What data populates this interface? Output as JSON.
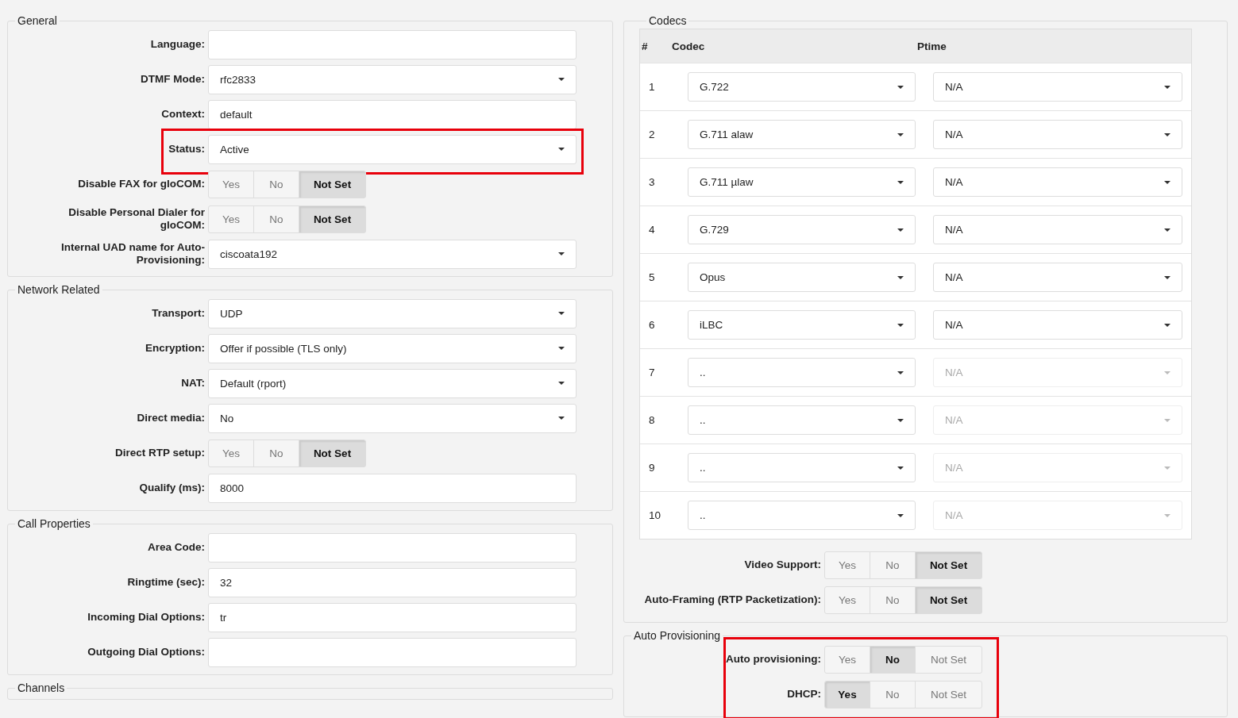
{
  "left_sections": [
    {
      "legend": "General",
      "highlighted": false,
      "fields": [
        {
          "kind": "text",
          "label": "Language:",
          "highlighted": false
        },
        {
          "kind": "select",
          "label": "DTMF Mode:",
          "value": "rfc2833",
          "highlighted": false
        },
        {
          "kind": "text",
          "label": "Context:",
          "value": "default",
          "highlighted": false
        },
        {
          "kind": "select",
          "label": "Status:",
          "value": "Active",
          "highlighted": true
        },
        {
          "kind": "toggle",
          "label": "Disable FAX for gloCOM:",
          "highlighted": false,
          "options": [
            {
              "label": "Yes",
              "selected": false
            },
            {
              "label": "No",
              "selected": false
            },
            {
              "label": "Not Set",
              "selected": true
            }
          ]
        },
        {
          "kind": "toggle",
          "label": "Disable Personal Dialer for gloCOM:",
          "highlighted": false,
          "options": [
            {
              "label": "Yes",
              "selected": false
            },
            {
              "label": "No",
              "selected": false
            },
            {
              "label": "Not Set",
              "selected": true
            }
          ]
        },
        {
          "kind": "select",
          "label": "Internal UAD name for Auto-Provisioning:",
          "value": "ciscoata192",
          "highlighted": false
        }
      ]
    },
    {
      "legend": "Network Related",
      "highlighted": false,
      "fields": [
        {
          "kind": "select",
          "label": "Transport:",
          "value": "UDP",
          "highlighted": false
        },
        {
          "kind": "select",
          "label": "Encryption:",
          "value": "Offer if possible (TLS only)",
          "highlighted": false
        },
        {
          "kind": "select",
          "label": "NAT:",
          "value": "Default (rport)",
          "highlighted": false
        },
        {
          "kind": "select",
          "label": "Direct media:",
          "value": "No",
          "highlighted": false
        },
        {
          "kind": "toggle",
          "label": "Direct RTP setup:",
          "highlighted": false,
          "options": [
            {
              "label": "Yes",
              "selected": false
            },
            {
              "label": "No",
              "selected": false
            },
            {
              "label": "Not Set",
              "selected": true
            }
          ]
        },
        {
          "kind": "text",
          "label": "Qualify (ms):",
          "value": "8000",
          "highlighted": false
        }
      ]
    },
    {
      "legend": "Call Properties",
      "highlighted": false,
      "fields": [
        {
          "kind": "text",
          "label": "Area Code:",
          "highlighted": false
        },
        {
          "kind": "text",
          "label": "Ringtime (sec):",
          "value": "32",
          "highlighted": false
        },
        {
          "kind": "text",
          "label": "Incoming Dial Options:",
          "value": "tr",
          "highlighted": false
        },
        {
          "kind": "text",
          "label": "Outgoing Dial Options:",
          "highlighted": false
        }
      ]
    },
    {
      "legend": "Channels",
      "highlighted": false
    }
  ],
  "codecs": {
    "legend": "Codecs",
    "columns": [
      "#",
      "Codec",
      "Ptime"
    ],
    "rows": [
      {
        "number": "1",
        "codec": "G.722",
        "ptime": "N/A",
        "ptime_disabled": false
      },
      {
        "number": "2",
        "codec": "G.711 alaw",
        "ptime": "N/A",
        "ptime_disabled": false
      },
      {
        "number": "3",
        "codec": "G.711 µlaw",
        "ptime": "N/A",
        "ptime_disabled": false
      },
      {
        "number": "4",
        "codec": "G.729",
        "ptime": "N/A",
        "ptime_disabled": false
      },
      {
        "number": "5",
        "codec": "Opus",
        "ptime": "N/A",
        "ptime_disabled": false
      },
      {
        "number": "6",
        "codec": "iLBC",
        "ptime": "N/A",
        "ptime_disabled": false
      },
      {
        "number": "7",
        "codec": "..",
        "ptime": "N/A",
        "ptime_disabled": true
      },
      {
        "number": "8",
        "codec": "..",
        "ptime": "N/A",
        "ptime_disabled": true
      },
      {
        "number": "9",
        "codec": "..",
        "ptime": "N/A",
        "ptime_disabled": true
      },
      {
        "number": "10",
        "codec": "..",
        "ptime": "N/A",
        "ptime_disabled": true
      }
    ],
    "fields": [
      {
        "kind": "toggle",
        "label": "Video Support:",
        "highlighted": false,
        "options": [
          {
            "label": "Yes",
            "selected": false
          },
          {
            "label": "No",
            "selected": false
          },
          {
            "label": "Not Set",
            "selected": true
          }
        ]
      },
      {
        "kind": "toggle",
        "label": "Auto-Framing (RTP Packetization):",
        "highlighted": false,
        "options": [
          {
            "label": "Yes",
            "selected": false
          },
          {
            "label": "No",
            "selected": false
          },
          {
            "label": "Not Set",
            "selected": true
          }
        ]
      }
    ]
  },
  "auto_provisioning": {
    "legend": "Auto Provisioning",
    "highlighted": true,
    "fields": [
      {
        "kind": "toggle",
        "label": "Auto provisioning:",
        "highlighted": false,
        "options": [
          {
            "label": "Yes",
            "selected": false
          },
          {
            "label": "No",
            "selected": true
          },
          {
            "label": "Not Set",
            "selected": false
          }
        ]
      },
      {
        "kind": "toggle",
        "label": "DHCP:",
        "highlighted": false,
        "options": [
          {
            "label": "Yes",
            "selected": true
          },
          {
            "label": "No",
            "selected": false
          },
          {
            "label": "Not Set",
            "selected": false
          }
        ]
      }
    ]
  }
}
